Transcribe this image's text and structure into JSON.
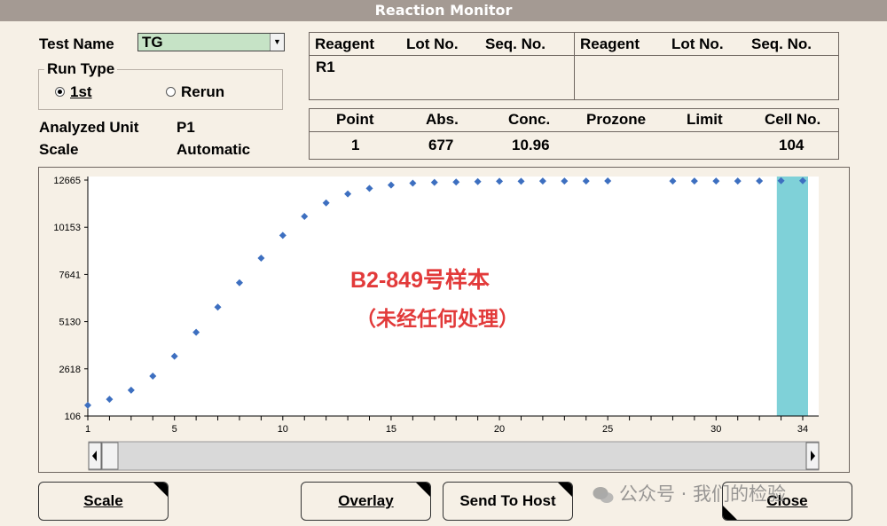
{
  "window": {
    "title": "Reaction Monitor"
  },
  "test": {
    "label": "Test Name",
    "value": "TG"
  },
  "run_type": {
    "label": "Run Type",
    "option1": "1st",
    "option2": "Rerun",
    "selected": "1st"
  },
  "analyzed_unit": {
    "label": "Analyzed Unit",
    "value": "P1"
  },
  "scale": {
    "label": "Scale",
    "value": "Automatic"
  },
  "reagent_table": {
    "headers": [
      "Reagent",
      "Lot No.",
      "Seq. No.",
      "Reagent",
      "Lot No.",
      "Seq. No."
    ],
    "left_reagent": "R1"
  },
  "point_table": {
    "headers": [
      "Point",
      "Abs.",
      "Conc.",
      "Prozone",
      "Limit",
      "Cell No."
    ],
    "row": [
      "1",
      "677",
      "10.96",
      "",
      "",
      "104"
    ]
  },
  "annotation": {
    "line1": "B2-849号样本",
    "line2": "（未经任何处理）"
  },
  "chart_data": {
    "type": "scatter",
    "x_ticks": [
      1,
      5,
      10,
      15,
      20,
      25,
      30,
      34
    ],
    "y_ticks": [
      106,
      2618,
      5130,
      7641,
      10153,
      12665
    ],
    "xlim": [
      1,
      34
    ],
    "ylim": [
      106,
      12665
    ],
    "series": [
      {
        "color": "#3d6fc0",
        "x": [
          1,
          2,
          3,
          4,
          5,
          6,
          7,
          8,
          9,
          10,
          11,
          12,
          13,
          14,
          15,
          16,
          17,
          18,
          19,
          20,
          21,
          22,
          23,
          24,
          25,
          28,
          29,
          30,
          31,
          32,
          33,
          34
        ],
        "y": [
          677,
          1000,
          1480,
          2230,
          3290,
          4560,
          5900,
          7200,
          8510,
          9720,
          10730,
          11450,
          11930,
          12220,
          12400,
          12500,
          12540,
          12560,
          12580,
          12600,
          12600,
          12610,
          12610,
          12610,
          12620,
          12610,
          12610,
          12610,
          12610,
          12620,
          12630,
          12630
        ]
      }
    ],
    "highlight_band": {
      "x_from": 33.05,
      "x_to": 34.0,
      "color": "#7fd1d8"
    },
    "grid": false
  },
  "buttons": {
    "scale": "Scale",
    "overlay": "Overlay",
    "send_to_host": "Send To Host",
    "close": "Close"
  },
  "watermark": "公众号 · 我们的检验"
}
